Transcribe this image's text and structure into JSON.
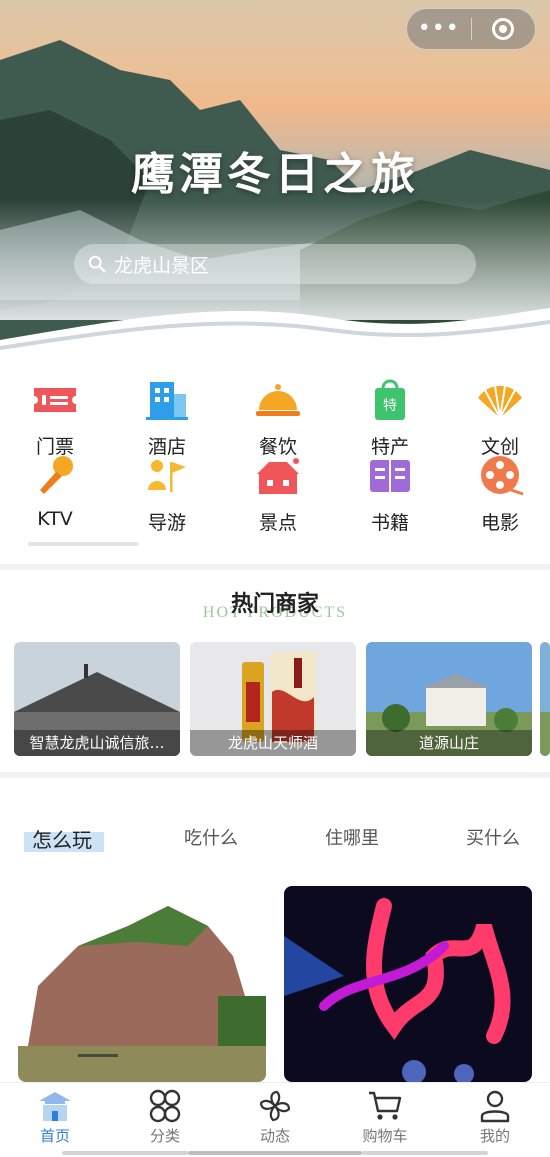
{
  "capsule": {
    "more_icon": "more-dots-icon",
    "close_icon": "target-circle-icon"
  },
  "hero": {
    "title": "鹰潭冬日之旅",
    "search_placeholder": "龙虎山景区"
  },
  "categories": [
    {
      "label": "门票",
      "icon": "ticket-icon",
      "color": "#f0555a"
    },
    {
      "label": "酒店",
      "icon": "hotel-icon",
      "color": "#2f9ee8"
    },
    {
      "label": "餐饮",
      "icon": "dish-cover-icon",
      "color": "#f5a623"
    },
    {
      "label": "特产",
      "icon": "shopping-bag-icon",
      "color": "#3ec46d"
    },
    {
      "label": "文创",
      "icon": "fan-icon",
      "color": "#f5a623"
    },
    {
      "label": "KTV",
      "icon": "microphone-icon",
      "color": "#f5a623"
    },
    {
      "label": "导游",
      "icon": "flag-guide-icon",
      "color": "#f5b82e"
    },
    {
      "label": "景点",
      "icon": "house-icon",
      "color": "#f0555a"
    },
    {
      "label": "书籍",
      "icon": "book-icon",
      "color": "#a06bd8"
    },
    {
      "label": "电影",
      "icon": "film-reel-icon",
      "color": "#f07a4a"
    }
  ],
  "hot": {
    "title": "热门商家",
    "subtitle": "HOT PRODUCTS",
    "shops": [
      {
        "name": "智慧龙虎山诚信旅…"
      },
      {
        "name": "龙虎山天师酒"
      },
      {
        "name": "道源山庄"
      }
    ]
  },
  "tabs": [
    {
      "label": "怎么玩"
    },
    {
      "label": "吃什么"
    },
    {
      "label": "住哪里"
    },
    {
      "label": "买什么"
    }
  ],
  "nav": [
    {
      "label": "首页",
      "icon": "home-pagoda-icon"
    },
    {
      "label": "分类",
      "icon": "category-icon"
    },
    {
      "label": "动态",
      "icon": "pinwheel-icon"
    },
    {
      "label": "购物车",
      "icon": "cart-icon"
    },
    {
      "label": "我的",
      "icon": "user-icon"
    }
  ],
  "colors": {
    "accent": "#2f7fd8",
    "tab_highlight": "#cde2f6",
    "subtitle": "#9dc79f"
  }
}
